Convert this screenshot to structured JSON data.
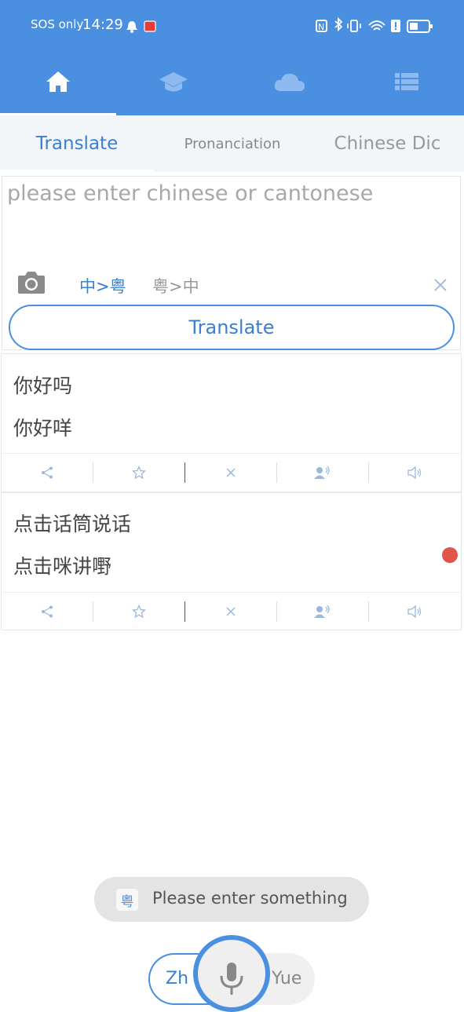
{
  "status_bar": {
    "carrier": "SOS only",
    "time": "14:29"
  },
  "nav": {
    "items": [
      {
        "icon": "home-icon",
        "active": true
      },
      {
        "icon": "graduation-cap-icon",
        "active": false
      },
      {
        "icon": "cloud-icon",
        "active": false
      },
      {
        "icon": "list-icon",
        "active": false
      }
    ]
  },
  "subtabs": [
    {
      "label": "Translate",
      "active": true
    },
    {
      "label": "Pronanciation",
      "active": false
    },
    {
      "label": "Chinese Dic",
      "active": false
    }
  ],
  "input": {
    "placeholder": "please enter chinese or cantonese",
    "direction_zh_yue": "中>粤",
    "direction_yue_zh": "粤>中",
    "translate_label": "Translate"
  },
  "results": [
    {
      "source": "你好吗",
      "target": "你好咩"
    },
    {
      "source": "点击话筒说话",
      "target": "点击咪讲嘢"
    }
  ],
  "toast": {
    "badge": "粤",
    "message": "Please enter something"
  },
  "voice": {
    "zh_label": "Zh",
    "yue_label": "Yue"
  },
  "colors": {
    "primary": "#4a8fe0",
    "record_dot": "#e0544a"
  }
}
